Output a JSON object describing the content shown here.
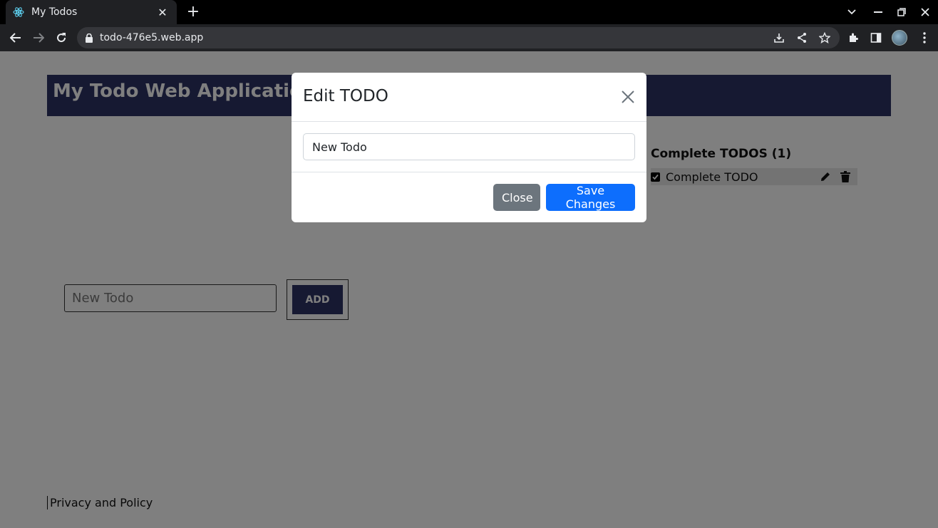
{
  "browser": {
    "tab_title": "My Todos",
    "url": "todo-476e5.web.app"
  },
  "page": {
    "header_title": "My Todo Web Application",
    "complete_section_title": "Complete TODOS (1)",
    "complete_items": [
      {
        "label": "Complete TODO",
        "checked": true
      }
    ],
    "new_todo_placeholder": "New Todo",
    "add_label": "ADD",
    "footer_link": "Privacy and Policy"
  },
  "modal": {
    "title": "Edit TODO",
    "input_value": "New Todo",
    "close_label": "Close",
    "save_label": "Save Changes"
  },
  "colors": {
    "header_bg": "#2c3265",
    "primary": "#0d6efd",
    "secondary": "#6c757d"
  }
}
